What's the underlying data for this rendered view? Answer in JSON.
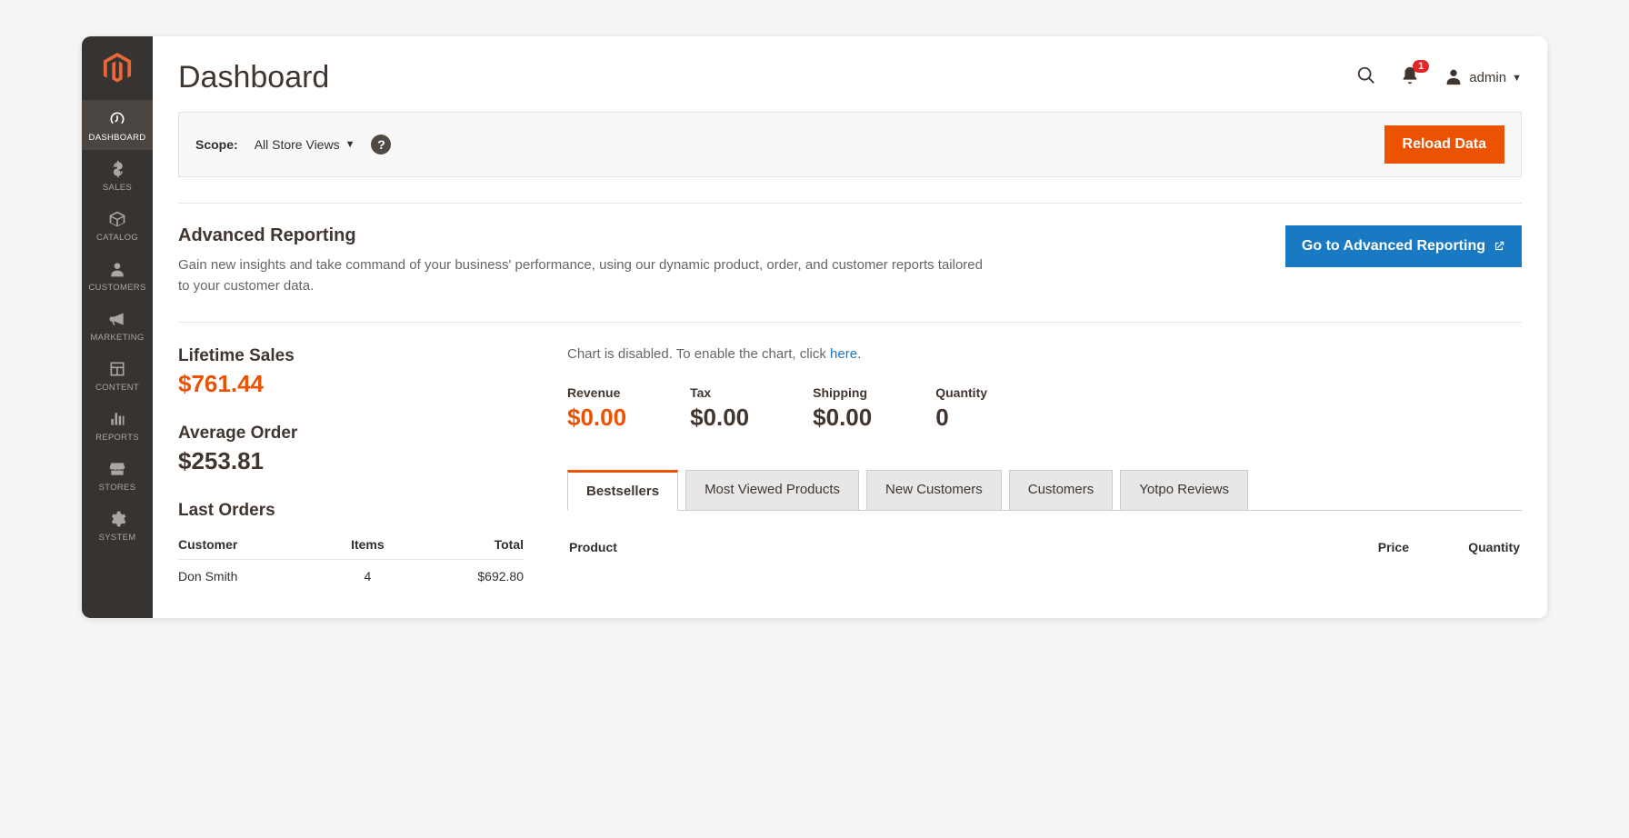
{
  "page": {
    "title": "Dashboard"
  },
  "user": {
    "name": "admin",
    "notifications": "1"
  },
  "scope": {
    "label": "Scope:",
    "value": "All Store Views",
    "reload_btn": "Reload Data"
  },
  "sidebar": {
    "items": [
      {
        "label": "DASHBOARD"
      },
      {
        "label": "SALES"
      },
      {
        "label": "CATALOG"
      },
      {
        "label": "CUSTOMERS"
      },
      {
        "label": "MARKETING"
      },
      {
        "label": "CONTENT"
      },
      {
        "label": "REPORTS"
      },
      {
        "label": "STORES"
      },
      {
        "label": "SYSTEM"
      }
    ]
  },
  "adv": {
    "title": "Advanced Reporting",
    "desc": "Gain new insights and take command of your business' performance, using our dynamic product, order, and customer reports tailored to your customer data.",
    "btn": "Go to Advanced Reporting"
  },
  "lifetime": {
    "label": "Lifetime Sales",
    "value": "$761.44"
  },
  "avgorder": {
    "label": "Average Order",
    "value": "$253.81"
  },
  "chartmsg": {
    "prefix": "Chart is disabled. To enable the chart, click ",
    "link": "here",
    "suffix": "."
  },
  "ministats": {
    "revenue": {
      "label": "Revenue",
      "value": "$0.00"
    },
    "tax": {
      "label": "Tax",
      "value": "$0.00"
    },
    "shipping": {
      "label": "Shipping",
      "value": "$0.00"
    },
    "quantity": {
      "label": "Quantity",
      "value": "0"
    }
  },
  "lastorders": {
    "title": "Last Orders",
    "cols": {
      "customer": "Customer",
      "items": "Items",
      "total": "Total"
    },
    "rows": [
      {
        "customer": "Don Smith",
        "items": "4",
        "total": "$692.80"
      }
    ]
  },
  "tabs": {
    "bestsellers": "Bestsellers",
    "mostviewed": "Most Viewed Products",
    "newcustomers": "New Customers",
    "customers": "Customers",
    "yotpo": "Yotpo Reviews"
  },
  "prodtable": {
    "cols": {
      "product": "Product",
      "price": "Price",
      "quantity": "Quantity"
    }
  }
}
